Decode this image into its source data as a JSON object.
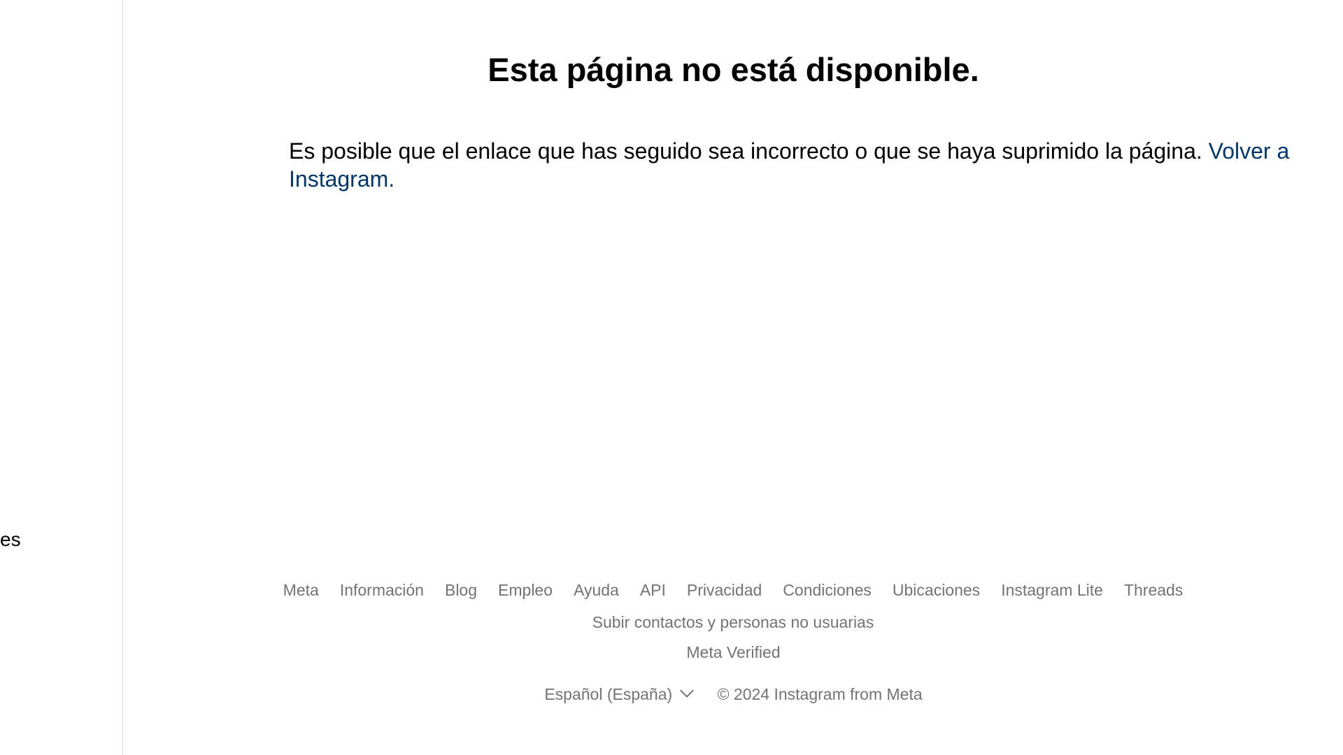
{
  "sidebar": {
    "visible_fragment": "es"
  },
  "main": {
    "title": "Esta página no está disponible.",
    "message": "Es posible que el enlace que has seguido sea incorrecto o que se haya suprimido la página.",
    "back_link": "Volver a Instagram."
  },
  "footer": {
    "links": [
      "Meta",
      "Información",
      "Blog",
      "Empleo",
      "Ayuda",
      "API",
      "Privacidad",
      "Condiciones",
      "Ubicaciones",
      "Instagram Lite",
      "Threads",
      "Subir contactos y personas no usuarias"
    ],
    "second_row": "Meta Verified",
    "language": "Español (España)",
    "copyright": "© 2024 Instagram from Meta"
  }
}
